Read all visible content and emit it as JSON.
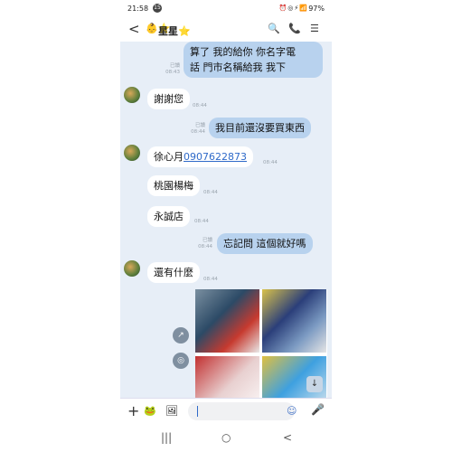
{
  "status": {
    "time": "21:58",
    "notif_count": "15",
    "icons": "⏰◎⚡📶",
    "battery": "97%"
  },
  "header": {
    "back": "<",
    "avatar_emoji": "👶⭐",
    "title": "星星⭐",
    "search": "🔍",
    "call": "📞",
    "menu": "☰"
  },
  "messages": [
    {
      "dir": "out",
      "text_lines": [
        "算了 我的給你 你名字電",
        "話 門市名稱給我 我下"
      ],
      "read": "已讀",
      "time": "08:43"
    },
    {
      "dir": "in",
      "text": "謝謝您",
      "time": "08:44"
    },
    {
      "dir": "out",
      "text": "我目前還沒要買東西",
      "read": "已讀",
      "time": "08:44"
    },
    {
      "dir": "in",
      "name": "徐心月",
      "phone": "0907622873",
      "time": "08:44"
    },
    {
      "dir": "in",
      "text": "桃園楊梅",
      "time": "08:44"
    },
    {
      "dir": "in",
      "text": "永誠店",
      "time": "08:44"
    },
    {
      "dir": "out",
      "text": "忘記問 這個就好嗎",
      "read": "已讀",
      "time": "08:44"
    },
    {
      "dir": "in",
      "text": "還有什麼",
      "time": "08:44"
    }
  ],
  "photo_actions": {
    "share": "↗",
    "more": "◎",
    "scroll_down": "↓"
  },
  "input": {
    "plus": "+",
    "sticker": "🐸",
    "image": "🖼",
    "placeholder": "",
    "emoji": "☺",
    "mic": "🎤"
  },
  "nav": {
    "recent": "|||",
    "home": "○",
    "back": "<"
  }
}
